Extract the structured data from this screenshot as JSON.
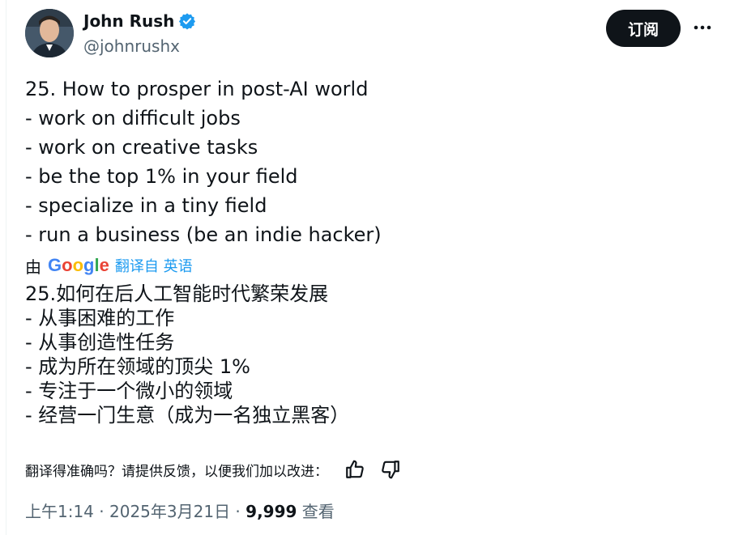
{
  "author": {
    "name": "John Rush",
    "handle": "@johnrushx",
    "verified_color": "#1d9bf0"
  },
  "actions": {
    "subscribe_label": "订阅",
    "more_icon": "more-horizontal-icon"
  },
  "tweet": {
    "lines": [
      "25. How to prosper in post-AI world",
      "- work on difficult jobs",
      "- work on creative tasks",
      "- be the top 1% in your field",
      "- specialize in a tiny field",
      "- run a business (be an indie hacker)"
    ]
  },
  "translation": {
    "by_label": "由",
    "provider": "Google",
    "link_label": "翻译自 英语",
    "lines": [
      "25.如何在后人工智能时代繁荣发展",
      "- 从事困难的工作",
      "- 从事创造性任务",
      "- 成为所在领域的顶尖 1%",
      "- 专注于一个微小的领域",
      "- 经营一门生意（成为一名独立黑客）"
    ],
    "feedback_prompt": "翻译得准确吗？请提供反馈，以便我们加以改进：",
    "thumbs_up_icon": "thumbs-up-icon",
    "thumbs_down_icon": "thumbs-down-icon"
  },
  "meta": {
    "time": "上午1:14",
    "separator": " · ",
    "date": "2025年3月21日",
    "views_count": "9,999",
    "views_label": "查看"
  }
}
